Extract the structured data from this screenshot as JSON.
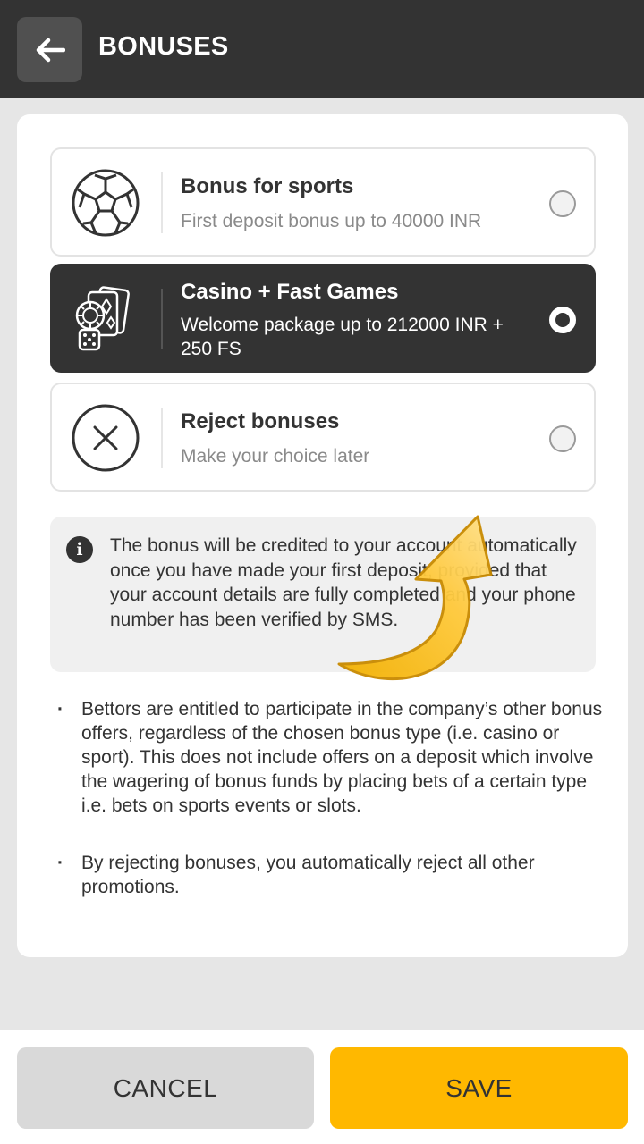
{
  "header": {
    "title": "BONUSES"
  },
  "options": [
    {
      "title": "Bonus for sports",
      "desc": "First deposit bonus up to 40000 INR",
      "icon": "soccer-ball-icon",
      "selected": false
    },
    {
      "title": "Casino + Fast Games",
      "desc": "Welcome package up to 212000 INR + 250 FS",
      "icon": "casino-chips-cards-dice-icon",
      "selected": true
    },
    {
      "title": "Reject bonuses",
      "desc": "Make your choice later",
      "icon": "circle-x-icon",
      "selected": false
    }
  ],
  "info": {
    "icon": "info-icon",
    "text": "The bonus will be credited to your account automatically once you have made your first deposit, provided that your account details are fully completed and your phone number has been verified by SMS."
  },
  "notes": [
    "Bettors are entitled to participate in the company’s other bonus offers, regardless of the chosen bonus type (i.e. casino or sport). This does not include offers on a deposit which involve the wagering of bonus funds by placing bets of a certain type i.e. bets on sports events or slots.",
    "By rejecting bonuses, you automatically reject all other promotions."
  ],
  "footer": {
    "cancel_label": "CANCEL",
    "save_label": "SAVE"
  },
  "colors": {
    "dark": "#333333",
    "accent": "#ffb800",
    "arrow": "#f5b800"
  }
}
